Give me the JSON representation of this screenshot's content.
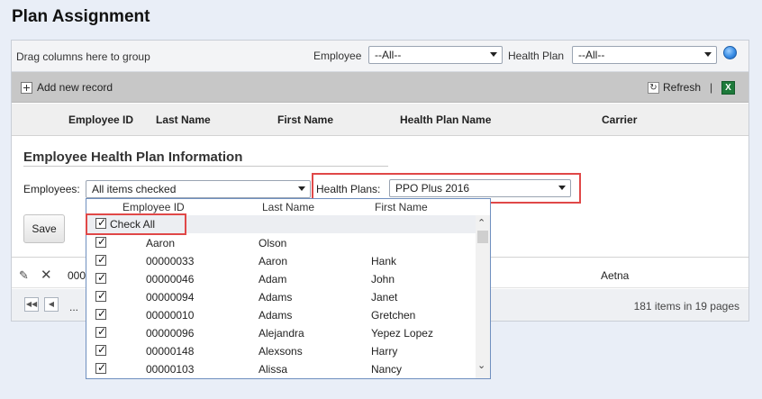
{
  "page": {
    "title": "Plan Assignment"
  },
  "group_bar": {
    "hint": "Drag columns here to group",
    "employee_label": "Employee",
    "employee_value": "--All--",
    "health_plan_label": "Health Plan",
    "health_plan_value": "--All--"
  },
  "toolbar": {
    "add_label": "Add new record",
    "refresh_label": "Refresh",
    "separator": "|"
  },
  "columns": [
    "Employee ID",
    "Last Name",
    "First Name",
    "Health Plan Name",
    "Carrier"
  ],
  "form": {
    "title": "Employee Health Plan Information",
    "employees_label": "Employees:",
    "employees_value": "All items checked",
    "health_plans_label": "Health Plans:",
    "health_plans_value": "PPO Plus 2016",
    "save_label": "Save"
  },
  "dropdown": {
    "headers": [
      "Employee ID",
      "Last Name",
      "First Name"
    ],
    "check_all_label": "Check All",
    "items": [
      {
        "id": "Aaron",
        "last": "Olson",
        "first": ""
      },
      {
        "id": "00000033",
        "last": "Aaron",
        "first": "Hank"
      },
      {
        "id": "00000046",
        "last": "Adam",
        "first": "John"
      },
      {
        "id": "00000094",
        "last": "Adams",
        "first": "Janet"
      },
      {
        "id": "00000010",
        "last": "Adams",
        "first": "Gretchen"
      },
      {
        "id": "00000096",
        "last": "Alejandra",
        "first": "Yepez Lopez"
      },
      {
        "id": "00000148",
        "last": "Alexsons",
        "first": "Harry"
      },
      {
        "id": "00000103",
        "last": "Alissa",
        "first": "Nancy"
      }
    ]
  },
  "data_row": {
    "id": "000",
    "carrier": "Aetna"
  },
  "pager": {
    "ellipsis": "...",
    "info": "181 items in 19 pages"
  },
  "colors": {
    "highlight": "#e04848",
    "toolbar": "#c7c7c7",
    "dropdown_border": "#6f8fbf"
  },
  "icons": [
    "plus-icon",
    "refresh-icon",
    "excel-icon",
    "globe-icon",
    "pencil-icon",
    "delete-icon",
    "checkbox-icon",
    "first-page-icon",
    "prev-page-icon",
    "scroll-up-icon",
    "scroll-down-icon"
  ]
}
